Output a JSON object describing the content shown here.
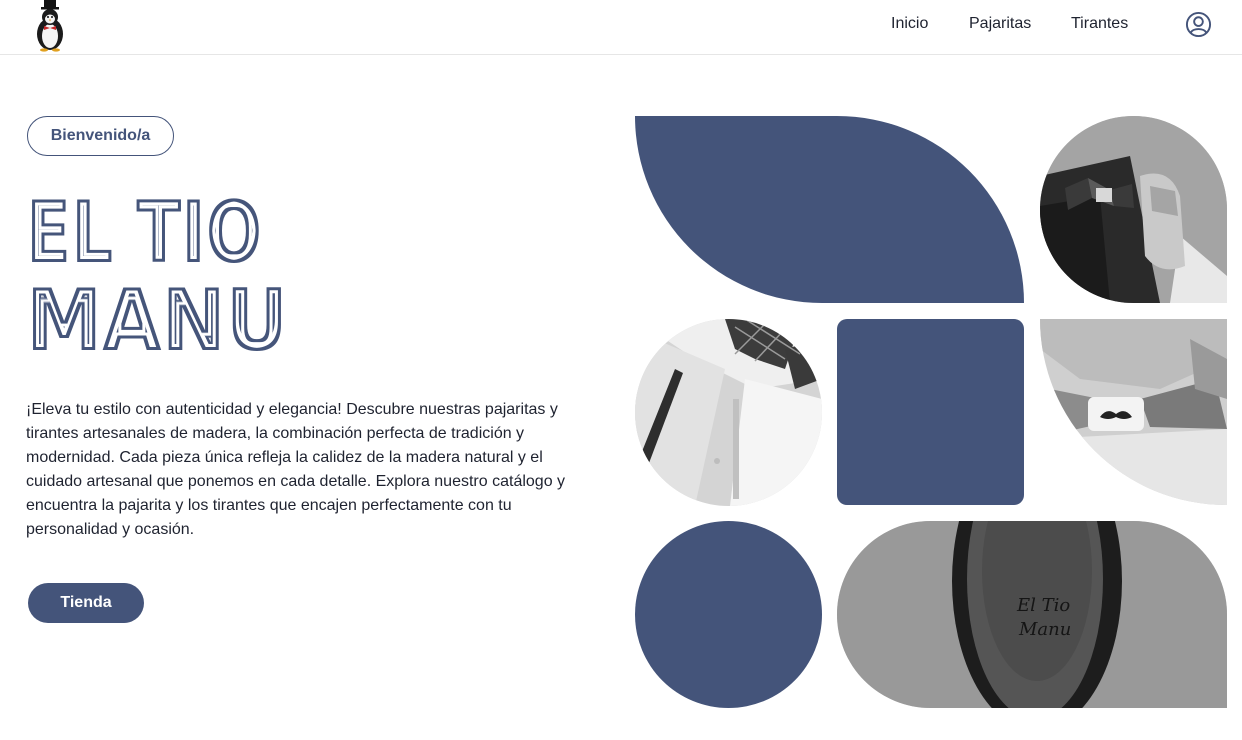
{
  "nav": {
    "links": [
      {
        "label": "Inicio"
      },
      {
        "label": "Pajaritas"
      },
      {
        "label": "Tirantes"
      }
    ],
    "logo_icon": "penguin-top-hat-logo",
    "user_icon": "user-circle-icon"
  },
  "hero": {
    "badge": "Bienvenido/a",
    "title_line1": "EL TIO",
    "title_line2": "MANU",
    "description": "¡Eleva tu estilo con autenticidad y elegancia! Descubre nuestras pajaritas y tirantes artesanales de madera, la combinación perfecta de tradición y modernidad. Cada pieza única refleja la calidez de la madera natural y el cuidado artesanal que ponemos en cada detalle. Explora nuestro catálogo y encuentra la pajarita y los tirantes que encajen perfectamente con tu personalidad y ocasión.",
    "cta": "Tienda"
  },
  "gallery": {
    "engraving_line1": "El Tio",
    "engraving_line2": "Manu"
  },
  "colors": {
    "accent": "#44547a",
    "text": "#1f2330",
    "background": "#ffffff"
  }
}
